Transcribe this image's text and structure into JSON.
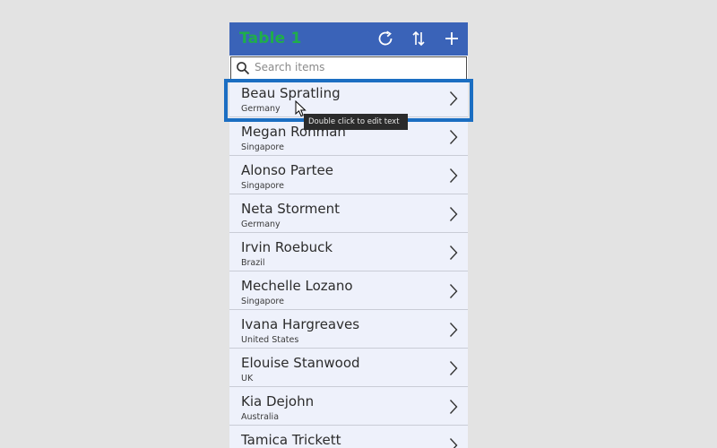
{
  "header": {
    "title": "Table 1",
    "refresh_icon": "refresh-icon",
    "sort_icon": "sort-icon",
    "add_icon": "add-icon"
  },
  "search": {
    "placeholder": "Search items",
    "value": ""
  },
  "tooltip": {
    "text": "Double click to edit text"
  },
  "items": [
    {
      "title": "Beau Spratling",
      "subtitle": "Germany"
    },
    {
      "title": "Megan Ronman",
      "subtitle": "Singapore"
    },
    {
      "title": "Alonso Partee",
      "subtitle": "Singapore"
    },
    {
      "title": "Neta Storment",
      "subtitle": "Germany"
    },
    {
      "title": "Irvin Roebuck",
      "subtitle": "Brazil"
    },
    {
      "title": "Mechelle Lozano",
      "subtitle": "Singapore"
    },
    {
      "title": "Ivana Hargreaves",
      "subtitle": "United States"
    },
    {
      "title": "Elouise Stanwood",
      "subtitle": "UK"
    },
    {
      "title": "Kia Dejohn",
      "subtitle": "Australia"
    },
    {
      "title": "Tamica Trickett",
      "subtitle": ""
    }
  ],
  "colors": {
    "header_bg": "#3a63b8",
    "title_green": "#1fae4a",
    "row_bg": "#eef1fb",
    "selection_blue": "#1b6ec2"
  }
}
